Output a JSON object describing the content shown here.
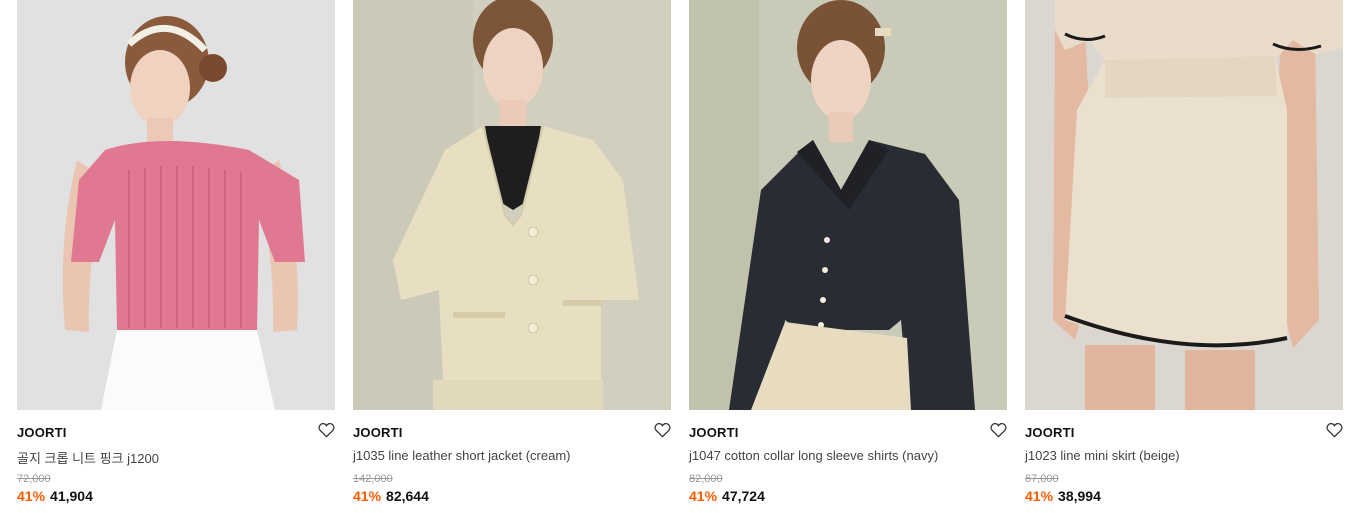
{
  "products": [
    {
      "brand": "JOORTI",
      "name": "골지 크롭 니트 핑크 j1200",
      "original_price": "72,000",
      "discount": "41%",
      "sale_price": "41,904",
      "image": "woman-in-pink-knit-top"
    },
    {
      "brand": "JOORTI",
      "name": "j1035 line leather short jacket (cream)",
      "original_price": "142,000",
      "discount": "41%",
      "sale_price": "82,644",
      "image": "woman-in-cream-leather-jacket"
    },
    {
      "brand": "JOORTI",
      "name": "j1047 cotton collar long sleeve shirts (navy)",
      "original_price": "82,000",
      "discount": "41%",
      "sale_price": "47,724",
      "image": "woman-in-navy-collar-shirt"
    },
    {
      "brand": "JOORTI",
      "name": "j1023 line mini skirt (beige)",
      "original_price": "67,000",
      "discount": "41%",
      "sale_price": "38,994",
      "image": "woman-in-beige-mini-skirt"
    }
  ],
  "icons": {
    "wishlist": "heart-outline-icon"
  },
  "colors": {
    "discount": "#ff5a00",
    "text": "#111111",
    "strike": "#999999"
  }
}
